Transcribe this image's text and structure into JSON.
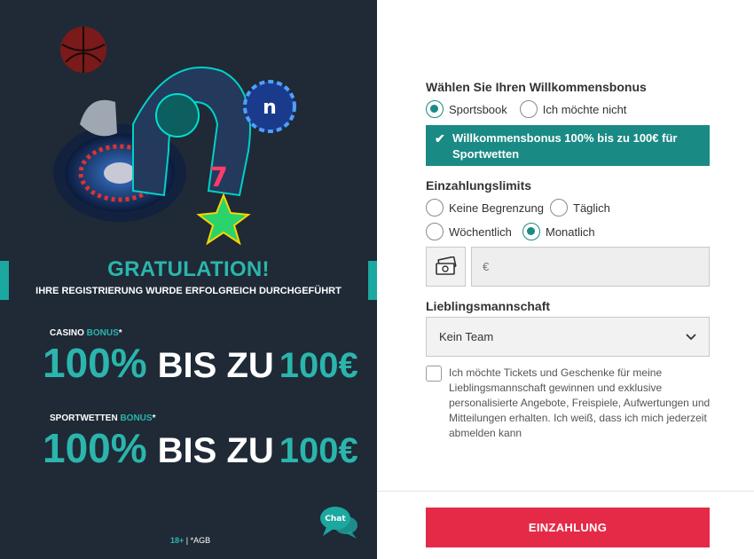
{
  "promo": {
    "title": "GRATULATION!",
    "subtitle": "IHRE REGISTRIERUNG WURDE ERFOLGREICH DURCHGEFÜHRT",
    "casino": {
      "label_a": "CASINO ",
      "label_b": "BONUS",
      "label_star": "*",
      "pct": "100%",
      "mid": "BIS ZU",
      "amt": "100€"
    },
    "sports": {
      "label_a": "SPORTWETTEN ",
      "label_b": "BONUS",
      "label_star": "*",
      "pct": "100%",
      "mid": "BIS ZU",
      "amt": "100€"
    },
    "footer_age": "18+",
    "footer_sep": " | ",
    "footer_agb": "*AGB",
    "chat_label": "Chat"
  },
  "form": {
    "bonus_title": "Wählen Sie Ihren Willkommensbonus",
    "bonus_options": [
      "Sportsbook",
      "Ich möchte nicht"
    ],
    "bonus_selected": "Sportsbook",
    "bonus_banner": "Willkommensbonus 100% bis zu 100€ für Sportwetten",
    "limits_title": "Einzahlungslimits",
    "limit_options": [
      "Keine Begrenzung",
      "Täglich",
      "Wöchentlich",
      "Monatlich"
    ],
    "limit_selected": "Monatlich",
    "amount_placeholder": "€",
    "team_title": "Lieblingsmannschaft",
    "team_selected": "Kein Team",
    "consent_text": "Ich möchte Tickets und Geschenke für meine Lieblingsmannschaft gewinnen und exklusive personalisierte Angebote, Freispiele, Aufwertungen und Mitteilungen erhalten. Ich weiß, dass ich mich jederzeit abmelden kann",
    "submit_label": "EINZAHLUNG"
  },
  "colors": {
    "teal": "#1a8a84",
    "teal_light": "#2bb5ac",
    "dark_bg": "#1f2a36",
    "cta": "#e52a48"
  },
  "icons": {
    "check": "check-icon",
    "money": "money-icon",
    "chevron": "chevron-down-icon",
    "chat": "chat-bubble-icon"
  }
}
